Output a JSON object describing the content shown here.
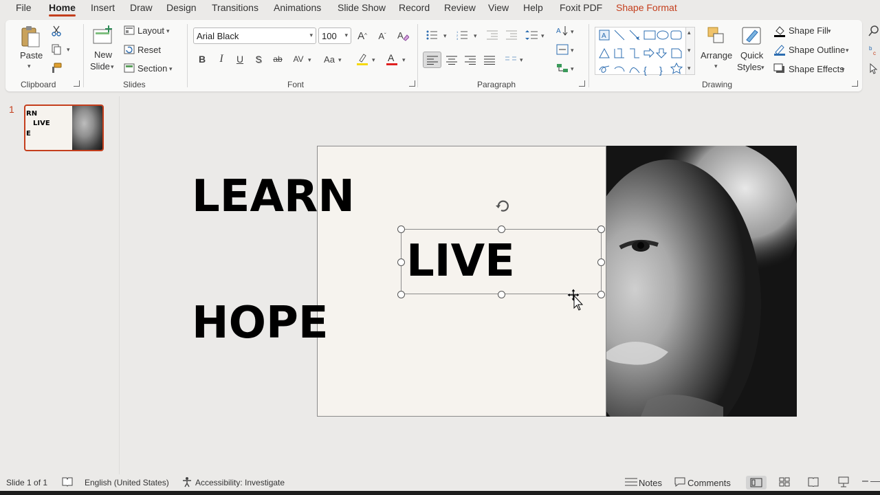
{
  "menu": {
    "tabs": [
      "File",
      "Home",
      "Insert",
      "Draw",
      "Design",
      "Transitions",
      "Animations",
      "Slide Show",
      "Record",
      "Review",
      "View",
      "Help",
      "Foxit PDF",
      "Shape Format"
    ],
    "active": "Home",
    "contextual_color": "#c43e1c"
  },
  "ribbon": {
    "clipboard": {
      "label": "Clipboard",
      "paste": "Paste"
    },
    "slides": {
      "label": "Slides",
      "new_slide_1": "New",
      "new_slide_2": "Slide",
      "layout": "Layout",
      "reset": "Reset",
      "section": "Section"
    },
    "font": {
      "label": "Font",
      "font_name": "Arial Black",
      "font_size": "100",
      "bold": "B",
      "italic": "I",
      "underline": "U",
      "shadow": "S",
      "strike": "ab",
      "spacing": "AV",
      "case": "Aa"
    },
    "paragraph": {
      "label": "Paragraph"
    },
    "drawing": {
      "label": "Drawing",
      "arrange": "Arrange",
      "quick_styles_1": "Quick",
      "quick_styles_2": "Styles",
      "shape_fill": "Shape Fill",
      "shape_outline": "Shape Outline",
      "shape_effects": "Shape Effects"
    }
  },
  "slide_panel": {
    "number": "1",
    "thumb_lines": [
      "RN",
      "LIVE",
      "E"
    ]
  },
  "slide": {
    "word1": "LEARN",
    "word2": "LIVE",
    "word3": "HOPE"
  },
  "status": {
    "slide_info": "Slide 1 of 1",
    "language": "English (United States)",
    "accessibility": "Accessibility: Investigate",
    "notes": "Notes",
    "comments": "Comments"
  },
  "colors": {
    "accent": "#c43e1c",
    "highlight": "#f5d90a",
    "font_color": "#e02020"
  }
}
